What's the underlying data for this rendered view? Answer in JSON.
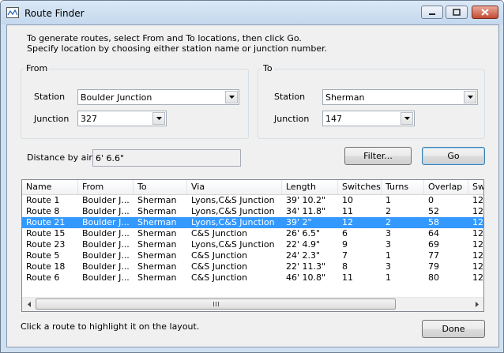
{
  "window": {
    "title": "Route Finder"
  },
  "instructions": {
    "line1": "To generate routes, select From and To locations, then click Go.",
    "line2": "Specify location by choosing either station name or junction number."
  },
  "from": {
    "group_label": "From",
    "station_label": "Station",
    "station_value": "Boulder Junction",
    "junction_label": "Junction",
    "junction_value": "327"
  },
  "to": {
    "group_label": "To",
    "station_label": "Station",
    "station_value": "Sherman",
    "junction_label": "Junction",
    "junction_value": "147"
  },
  "distance": {
    "label": "Distance by air",
    "value": "6' 6.6\""
  },
  "buttons": {
    "filter": "Filter...",
    "go": "Go",
    "done": "Done"
  },
  "table": {
    "columns": [
      "Name",
      "From",
      "To",
      "Via",
      "Length",
      "Switches",
      "Turns",
      "Overlap",
      "Sw"
    ],
    "rows": [
      [
        "Route 1",
        "Boulder J...",
        "Sherman",
        "Lyons,C&S Junction",
        "39' 10.2\"",
        "10",
        "1",
        "0",
        "12"
      ],
      [
        "Route 8",
        "Boulder J...",
        "Sherman",
        "Lyons,C&S Junction",
        "34' 11.8\"",
        "11",
        "2",
        "52",
        "12"
      ],
      [
        "Route 21",
        "Boulder J...",
        "Sherman",
        "Lyons,C&S Junction",
        "39' 2\"",
        "12",
        "2",
        "58",
        "12"
      ],
      [
        "Route 15",
        "Boulder J...",
        "Sherman",
        "C&S Junction",
        "26' 6.5\"",
        "6",
        "3",
        "64",
        "12"
      ],
      [
        "Route 23",
        "Boulder J...",
        "Sherman",
        "Lyons,C&S Junction",
        "22' 4.9\"",
        "9",
        "3",
        "69",
        "12"
      ],
      [
        "Route 5",
        "Boulder J...",
        "Sherman",
        "C&S Junction",
        "24' 2.3\"",
        "7",
        "1",
        "77",
        "12"
      ],
      [
        "Route 18",
        "Boulder J...",
        "Sherman",
        "C&S Junction",
        "22' 11.3\"",
        "8",
        "3",
        "79",
        "12"
      ],
      [
        "Route 6",
        "Boulder J...",
        "Sherman",
        "C&S Junction",
        "46' 10.8\"",
        "11",
        "1",
        "80",
        "12"
      ]
    ],
    "selected_row": 2
  },
  "hint": "Click a route to highlight it on the layout.",
  "colors": {
    "selection": "#3399ff",
    "title_bg": "#cfe0f1"
  }
}
